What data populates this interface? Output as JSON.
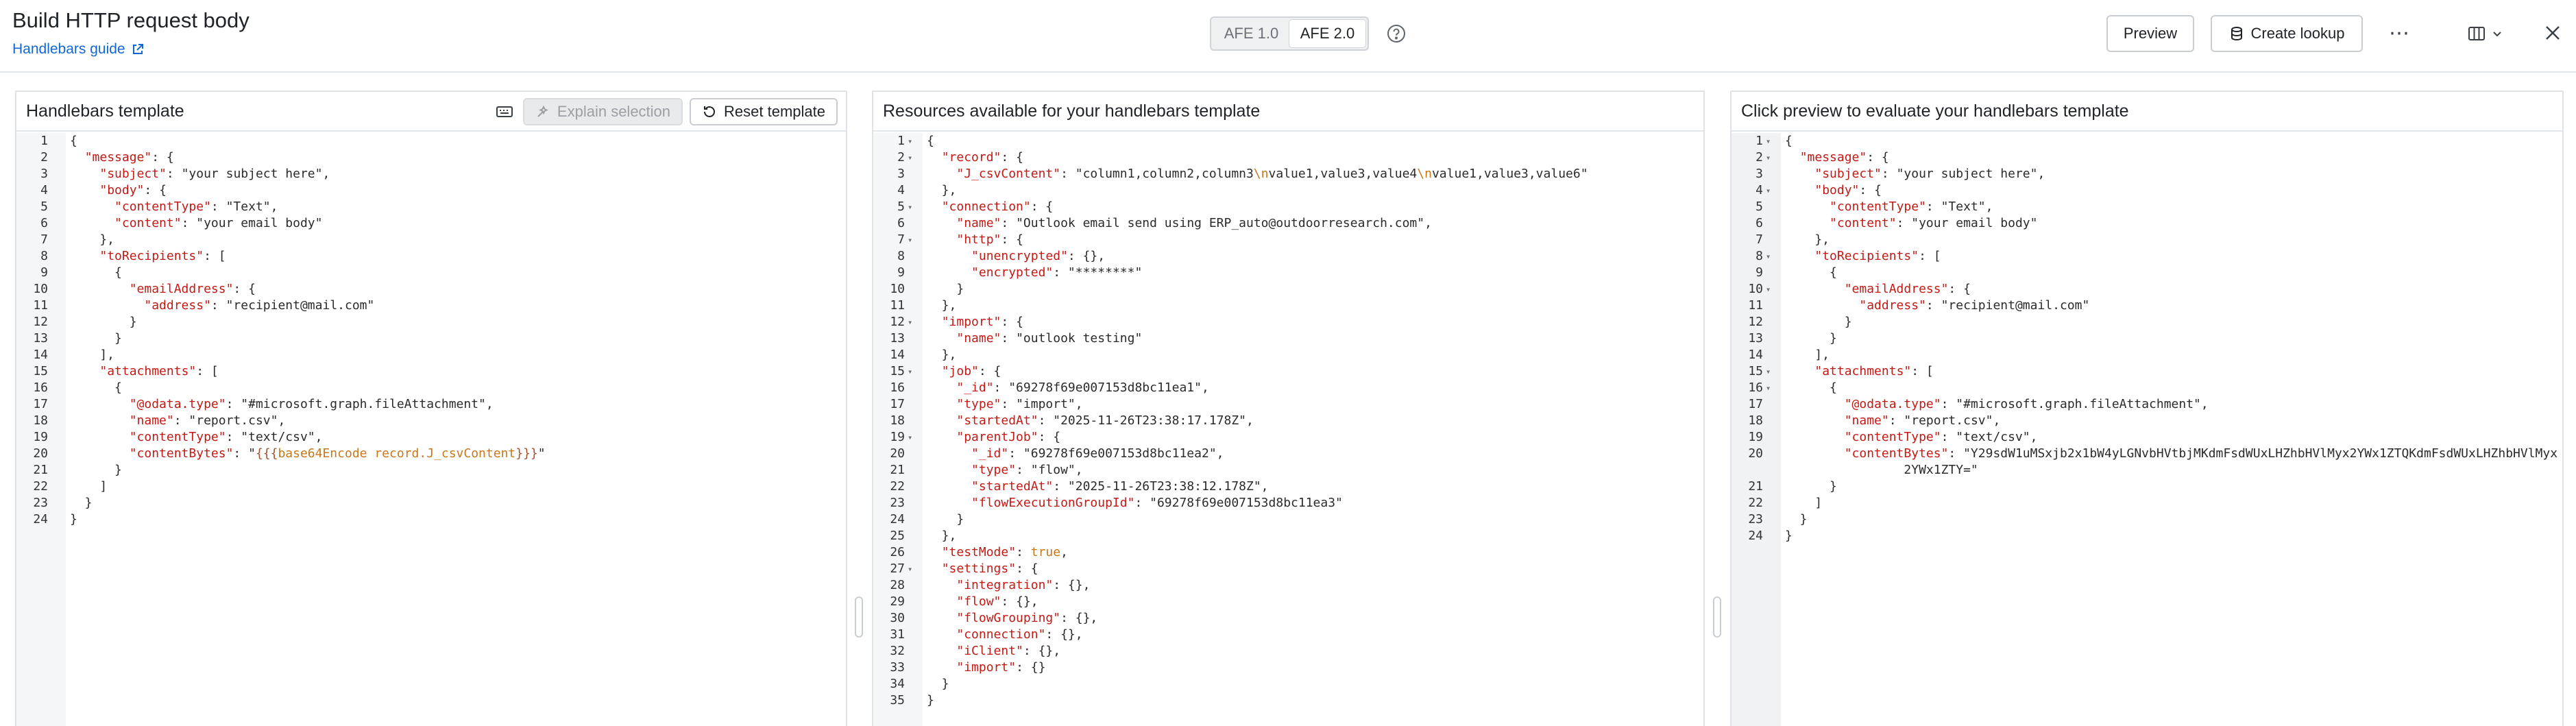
{
  "header": {
    "title": "Build HTTP request body",
    "guide_link": "Handlebars guide",
    "afe_options": [
      "AFE 1.0",
      "AFE 2.0"
    ],
    "afe_selected": "AFE 2.0",
    "preview_label": "Preview",
    "create_lookup_label": "Create lookup",
    "more_label": "⋯"
  },
  "panels": {
    "template": {
      "title": "Handlebars template",
      "explain_label": "Explain selection",
      "reset_label": "Reset template",
      "lines": [
        "{",
        "  \"message\": {",
        "    \"subject\": \"your subject here\",",
        "    \"body\": {",
        "      \"contentType\": \"Text\",",
        "      \"content\": \"your email body\"",
        "    },",
        "    \"toRecipients\": [",
        "      {",
        "        \"emailAddress\": {",
        "          \"address\": \"recipient@mail.com\"",
        "        }",
        "      }",
        "    ],",
        "    \"attachments\": [",
        "      {",
        "        \"@odata.type\": \"#microsoft.graph.fileAttachment\",",
        "        \"name\": \"report.csv\",",
        "        \"contentType\": \"text/csv\",",
        "        \"contentBytes\": \"{{{base64Encode record.J_csvContent}}}\"",
        "      }",
        "    ]",
        "  }",
        "}"
      ]
    },
    "resources": {
      "title": "Resources available for your handlebars template",
      "lines": [
        "{",
        "  \"record\": {",
        "    \"J_csvContent\": \"column1,column2,column3\\nvalue1,value3,value4\\nvalue1,value3,value6\"",
        "  },",
        "  \"connection\": {",
        "    \"name\": \"Outlook email send using ERP_auto@outdoorresearch.com\",",
        "    \"http\": {",
        "      \"unencrypted\": {},",
        "      \"encrypted\": \"********\"",
        "    }",
        "  },",
        "  \"import\": {",
        "    \"name\": \"outlook testing\"",
        "  },",
        "  \"job\": {",
        "    \"_id\": \"69278f69e007153d8bc11ea1\",",
        "    \"type\": \"import\",",
        "    \"startedAt\": \"2025-11-26T23:38:17.178Z\",",
        "    \"parentJob\": {",
        "      \"_id\": \"69278f69e007153d8bc11ea2\",",
        "      \"type\": \"flow\",",
        "      \"startedAt\": \"2025-11-26T23:38:12.178Z\",",
        "      \"flowExecutionGroupId\": \"69278f69e007153d8bc11ea3\"",
        "    }",
        "  },",
        "  \"testMode\": true,",
        "  \"settings\": {",
        "    \"integration\": {},",
        "    \"flow\": {},",
        "    \"flowGrouping\": {},",
        "    \"connection\": {},",
        "    \"iClient\": {},",
        "    \"import\": {}",
        "  }",
        "}"
      ],
      "fold_lines": [
        1,
        2,
        5,
        7,
        12,
        15,
        19,
        27
      ]
    },
    "preview": {
      "title": "Click preview to evaluate your handlebars template",
      "lines": [
        "{",
        "  \"message\": {",
        "    \"subject\": \"your subject here\",",
        "    \"body\": {",
        "      \"contentType\": \"Text\",",
        "      \"content\": \"your email body\"",
        "    },",
        "    \"toRecipients\": [",
        "      {",
        "        \"emailAddress\": {",
        "          \"address\": \"recipient@mail.com\"",
        "        }",
        "      }",
        "    ],",
        "    \"attachments\": [",
        "      {",
        "        \"@odata.type\": \"#microsoft.graph.fileAttachment\",",
        "        \"name\": \"report.csv\",",
        "        \"contentType\": \"text/csv\",",
        "        \"contentBytes\": \"Y29sdW1uMSxjb2x1bW4yLGNvbHVtbjMKdmFsdWUxLHZhbHVlMyx2YWx1ZTQKdmFsdWUxLHZhbHVlMyx",
        "      }",
        "    ]",
        "  }",
        "}"
      ],
      "wrap_continuation": "2YWx1ZTY=\"",
      "fold_lines": [
        1,
        2,
        4,
        8,
        10,
        15,
        16
      ]
    }
  },
  "colors": {
    "key": "#c41a16",
    "link": "#1366d6",
    "border": "#dfe2e6"
  }
}
